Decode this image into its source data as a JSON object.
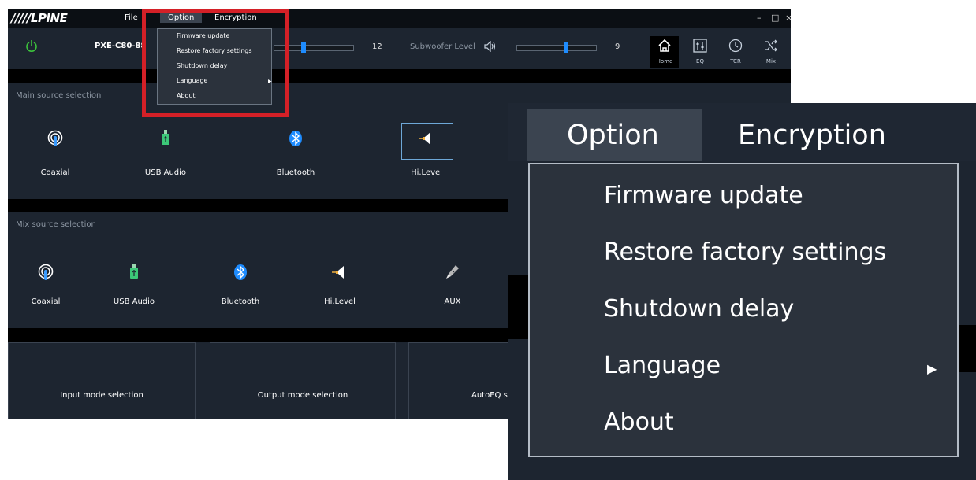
{
  "titlebar": {
    "brand": "/////LPINE",
    "menus": [
      "File",
      "Option",
      "Encryption"
    ],
    "window_controls": [
      "–",
      "□",
      "×"
    ]
  },
  "toolbar": {
    "device": "PXE-C80-88",
    "level_value": "12",
    "subwoofer_label": "Subwoofer Level",
    "subwoofer_value": "9",
    "nav": [
      "Home",
      "EQ",
      "TCR",
      "Mix"
    ]
  },
  "option_menu": {
    "items": [
      "Firmware update",
      "Restore factory settings",
      "Shutdown delay",
      "Language",
      "About"
    ],
    "submenu_arrow": "▶"
  },
  "main_source": {
    "title": "Main source selection",
    "items": [
      "Coaxial",
      "USB Audio",
      "Bluetooth",
      "Hi.Level"
    ]
  },
  "mix_source": {
    "title": "Mix source selection",
    "items": [
      "Coaxial",
      "USB Audio",
      "Bluetooth",
      "Hi.Level",
      "AUX"
    ]
  },
  "panels": [
    "Input mode selection",
    "Output mode selection",
    "AutoEQ s"
  ],
  "zoom": {
    "menus": [
      "Option",
      "Encryption"
    ],
    "items": [
      "Firmware update",
      "Restore factory settings",
      "Shutdown delay",
      "Language",
      "About"
    ],
    "submenu_arrow": "▶"
  },
  "colors": {
    "accent": "#1e8cff",
    "highlight_box": "#d42027",
    "power": "#3cc23c",
    "usb": "#3cc878"
  },
  "icons": {
    "coaxial": "coaxial-icon",
    "usb": "usb-icon",
    "bluetooth": "bluetooth-icon",
    "hilevel": "speaker-icon",
    "aux": "aux-plug-icon",
    "home": "home-icon",
    "eq": "eq-icon",
    "tcr": "clock-icon",
    "mix": "shuffle-icon",
    "power": "power-icon",
    "volume": "volume-icon"
  }
}
